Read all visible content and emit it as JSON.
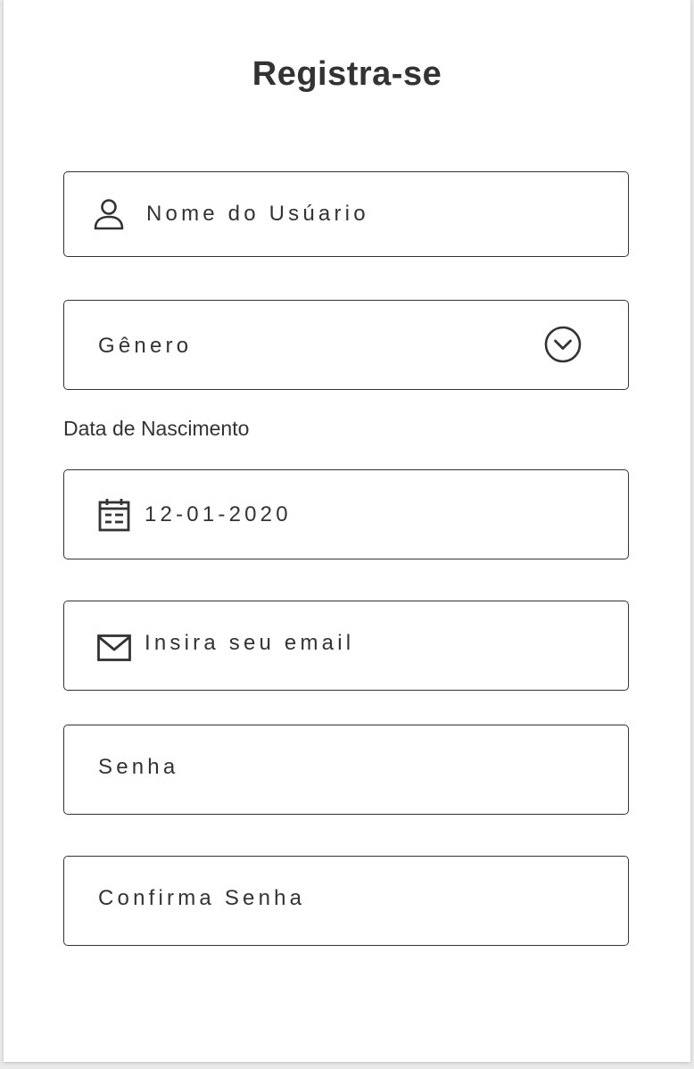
{
  "form": {
    "title": "Registra-se",
    "username": {
      "placeholder": "Nome do Usúario",
      "icon": "user-icon"
    },
    "gender": {
      "placeholder": "Gênero",
      "icon": "chevron-down-circle-icon"
    },
    "birthdate": {
      "label": "Data de Nascimento",
      "value": "12-01-2020",
      "icon": "calendar-icon"
    },
    "email": {
      "placeholder": "Insira seu email",
      "icon": "mail-icon"
    },
    "password": {
      "placeholder": "Senha"
    },
    "confirm_password": {
      "placeholder": "Confirma Senha"
    }
  },
  "colors": {
    "text": "#333333",
    "border": "#333333",
    "background": "#ffffff",
    "page": "#e9e9e9"
  }
}
